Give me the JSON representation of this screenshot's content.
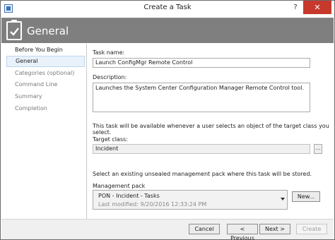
{
  "window": {
    "title": "Create a Task",
    "help_glyph": "?",
    "close_glyph": "✕"
  },
  "header": {
    "title": "General"
  },
  "nav": {
    "items": [
      {
        "label": "Before You Begin"
      },
      {
        "label": "General"
      },
      {
        "label": "Categories (optional)"
      },
      {
        "label": "Command Line"
      },
      {
        "label": "Summary"
      },
      {
        "label": "Completion"
      }
    ]
  },
  "form": {
    "task_name_label": "Task name:",
    "task_name_value": "Launch ConfigMgr Remote Control",
    "description_label": "Description:",
    "description_value": "Launches the System Center Configuration Manager Remote Control tool.",
    "availability_note": "This task will be available whenever a user selects an object of the target class you select.",
    "target_class_label": "Target class:",
    "target_class_value": "Incident",
    "browse_label": "...",
    "mp_note": "Select an existing unsealed management pack where this task will be stored.",
    "mp_label": "Management pack",
    "mp_name": "PON - Incident - Tasks",
    "mp_modified": "Last modified:  9/20/2016 12:33:24 PM",
    "new_button": "New..."
  },
  "footer": {
    "cancel": "Cancel",
    "previous": "< Previous",
    "next": "Next >",
    "create": "Create"
  }
}
